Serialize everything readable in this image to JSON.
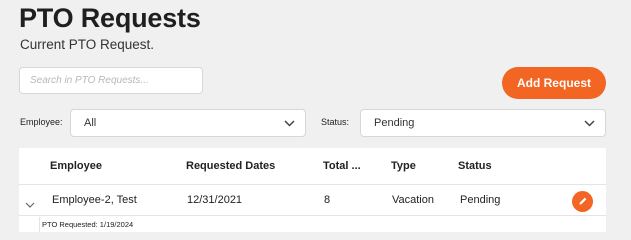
{
  "page": {
    "title": "PTO Requests",
    "subtitle": "Current PTO Request."
  },
  "search": {
    "placeholder": "Search in PTO Requests..."
  },
  "actions": {
    "add_request_label": "Add Request"
  },
  "filters": {
    "employee_label": "Employee:",
    "employee_value": "All",
    "status_label": "Status:",
    "status_value": "Pending"
  },
  "table": {
    "columns": [
      "Employee",
      "Requested Dates",
      "Total ...",
      "Type",
      "Status"
    ],
    "rows": [
      {
        "employee": "Employee-2, Test",
        "requested_dates": "12/31/2021",
        "total": "8",
        "type": "Vacation",
        "status": "Pending",
        "detail": "PTO Requested: 1/19/2024"
      }
    ]
  },
  "icons": {
    "expand": "chevron-down-icon",
    "edit": "pencil-icon",
    "select_caret": "chevron-down-icon"
  },
  "colors": {
    "accent": "#f26522",
    "background": "#f0f0f0"
  }
}
